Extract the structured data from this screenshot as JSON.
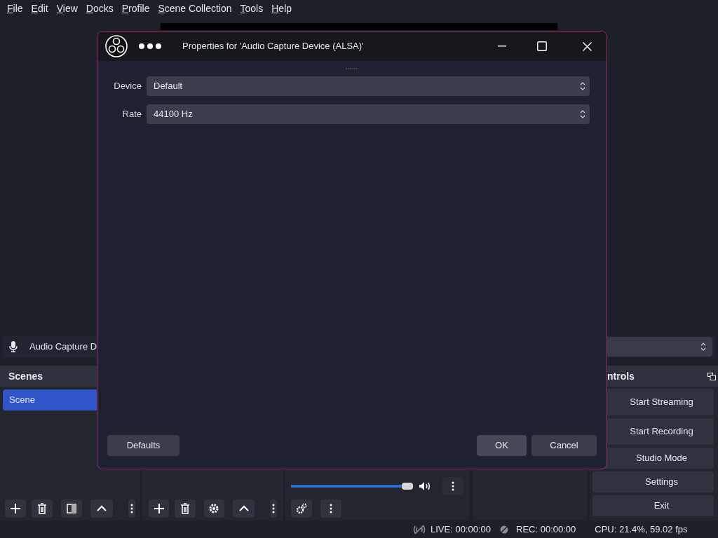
{
  "menu": [
    {
      "label": "File"
    },
    {
      "label": "Edit"
    },
    {
      "label": "View"
    },
    {
      "label": "Docks"
    },
    {
      "label": "Profile"
    },
    {
      "label": "Scene Collection"
    },
    {
      "label": "Tools"
    },
    {
      "label": "Help"
    }
  ],
  "source_toolbar": {
    "source": "Audio Capture D"
  },
  "scenes": {
    "title": "Scenes",
    "items": [
      {
        "label": "Scene",
        "selected": true
      }
    ]
  },
  "mixer": {
    "level": 0.96
  },
  "controls": {
    "title": "ntrols",
    "buttons": [
      {
        "label": "Start Streaming"
      },
      {
        "label": "Start Recording"
      },
      {
        "label": "Studio Mode"
      },
      {
        "label": "Settings"
      },
      {
        "label": "Exit"
      }
    ]
  },
  "status_bar": {
    "live": "LIVE: 00:00:00",
    "rec": "REC: 00:00:00",
    "cpu": "CPU: 21.4%, 59.02 fps"
  },
  "dialog": {
    "title": "Properties for 'Audio Capture Device (ALSA)'",
    "fields": [
      {
        "label": "Device",
        "value": "Default"
      },
      {
        "label": "Rate",
        "value": "44100 Hz"
      }
    ],
    "buttons": [
      {
        "label": "Defaults"
      },
      {
        "label": "OK"
      },
      {
        "label": "Cancel"
      }
    ]
  }
}
